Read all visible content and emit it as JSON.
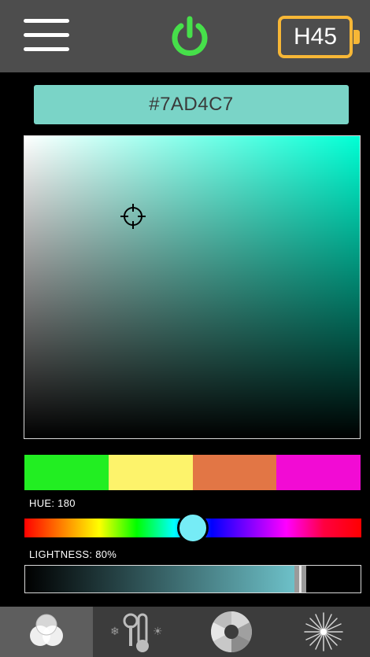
{
  "header": {
    "menu_icon": "hamburger-menu-icon",
    "power_icon": "power-icon",
    "power_color": "#46e04a",
    "device_label": "H45",
    "device_badge_color": "#f7b736"
  },
  "color": {
    "hex_label": "#7AD4C7",
    "hex_bar_color": "#7ad4c7",
    "field_hue_color": "#00ffd5",
    "cursor_icon": "crosshair-icon"
  },
  "swatches": [
    {
      "color": "#22ee22"
    },
    {
      "color": "#fdf36b"
    },
    {
      "color": "#e27645"
    },
    {
      "color": "#f20bd4"
    }
  ],
  "hue": {
    "label": "HUE: 180",
    "value": 180,
    "thumb_color": "#76ecf6"
  },
  "lightness": {
    "label": "LIGHTNESS: 80%",
    "value": 0.8,
    "fill_end_color": "#6fc4cc"
  },
  "tabs": [
    {
      "name": "color-mix-icon",
      "active": true
    },
    {
      "name": "temperature-icon",
      "active": false
    },
    {
      "name": "color-wheel-icon",
      "active": false
    },
    {
      "name": "effects-sparkle-icon",
      "active": false
    }
  ]
}
